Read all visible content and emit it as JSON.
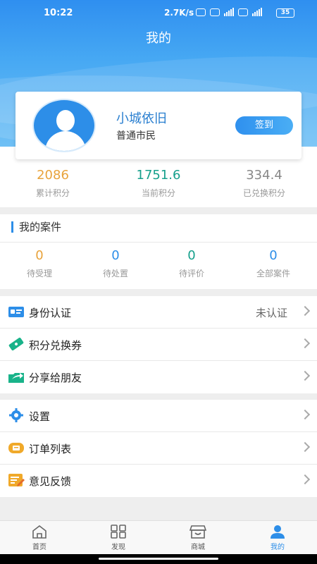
{
  "status_bar": {
    "time": "10:22",
    "speed": "2.7K/s",
    "battery": "35"
  },
  "page_title": "我的",
  "profile": {
    "name": "小城依旧",
    "role": "普通市民",
    "checkin_label": "签到"
  },
  "points": [
    {
      "value": "2086",
      "label": "累计积分",
      "color": "#e8a33c"
    },
    {
      "value": "1751.6",
      "label": "当前积分",
      "color": "#16a08c"
    },
    {
      "value": "334.4",
      "label": "已兑换积分",
      "color": "#888888"
    }
  ],
  "cases": {
    "title": "我的案件",
    "items": [
      {
        "value": "0",
        "label": "待受理",
        "color": "#e8a33c"
      },
      {
        "value": "0",
        "label": "待处置",
        "color": "#2d8ee8"
      },
      {
        "value": "0",
        "label": "待评价",
        "color": "#16a08c"
      },
      {
        "value": "0",
        "label": "全部案件",
        "color": "#2d8ee8"
      }
    ]
  },
  "menu_group1": [
    {
      "label": "身份认证",
      "value": "未认证",
      "icon": "id-card-icon"
    },
    {
      "label": "积分兑换券",
      "value": "",
      "icon": "coupon-icon"
    },
    {
      "label": "分享给朋友",
      "value": "",
      "icon": "share-icon"
    }
  ],
  "menu_group2": [
    {
      "label": "设置",
      "icon": "gear-icon"
    },
    {
      "label": "订单列表",
      "icon": "order-icon"
    },
    {
      "label": "意见反馈",
      "icon": "feedback-icon"
    }
  ],
  "bottom_nav": [
    {
      "label": "首页",
      "icon": "home-icon"
    },
    {
      "label": "发现",
      "icon": "grid-icon"
    },
    {
      "label": "商城",
      "icon": "shop-icon"
    },
    {
      "label": "我的",
      "icon": "user-icon",
      "active": true
    }
  ],
  "colors": {
    "primary": "#2d8ee8"
  }
}
